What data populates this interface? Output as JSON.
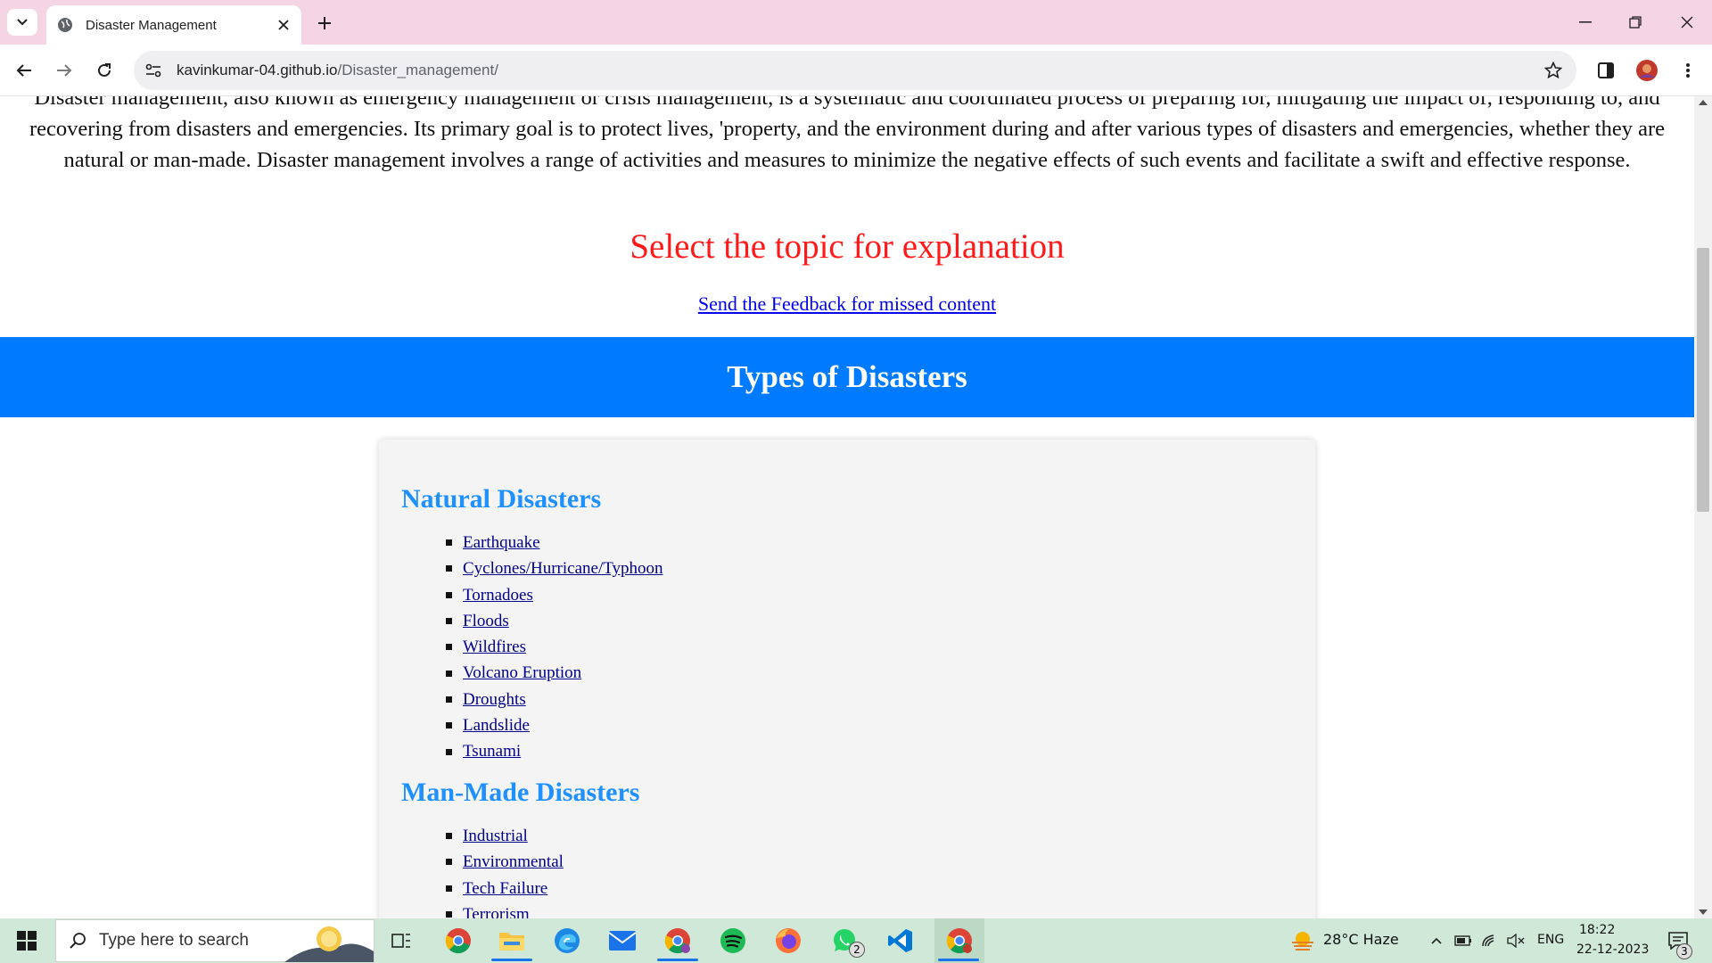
{
  "browser": {
    "tab_title": "Disaster Management",
    "url_host": "kavinkumar-04.github.io",
    "url_path": "/Disaster_management/"
  },
  "page": {
    "intro": "Disaster management, also known as emergency management or crisis management, is a systematic and coordinated process of preparing for, mitigating the impact of, responding to, and recovering from disasters and emergencies. Its primary goal is to protect lives, 'property, and the environment during and after various types of disasters and emergencies, whether they are natural or man-made. Disaster management involves a range of activities and measures to minimize the negative effects of such events and facilitate a swift and effective response.",
    "topic_heading": "Select the topic for explanation",
    "feedback_link": "Send the Feedback for missed content",
    "banner_title": "Types of Disasters",
    "natural_heading": "Natural Disasters",
    "natural_items": [
      "Earthquake",
      "Cyclones/Hurricane/Typhoon",
      "Tornadoes",
      "Floods",
      "Wildfires",
      "Volcano Eruption",
      "Droughts",
      "Landslide",
      "Tsunami"
    ],
    "manmade_heading": "Man-Made Disasters",
    "manmade_items": [
      "Industrial",
      "Environmental",
      "Tech Failure",
      "Terrorism"
    ]
  },
  "taskbar": {
    "search_placeholder": "Type here to search",
    "weather": "28°C  Haze",
    "language": "ENG",
    "time": "18:22",
    "date": "22-12-2023",
    "whatsapp_badge": "2",
    "notification_badge": "3"
  },
  "colors": {
    "tabbar": "#f5d4e4",
    "banner": "#007bff",
    "topic_heading": "#ff1a1a",
    "section_heading": "#1e90ff",
    "taskbar": "#cfe8d7"
  }
}
